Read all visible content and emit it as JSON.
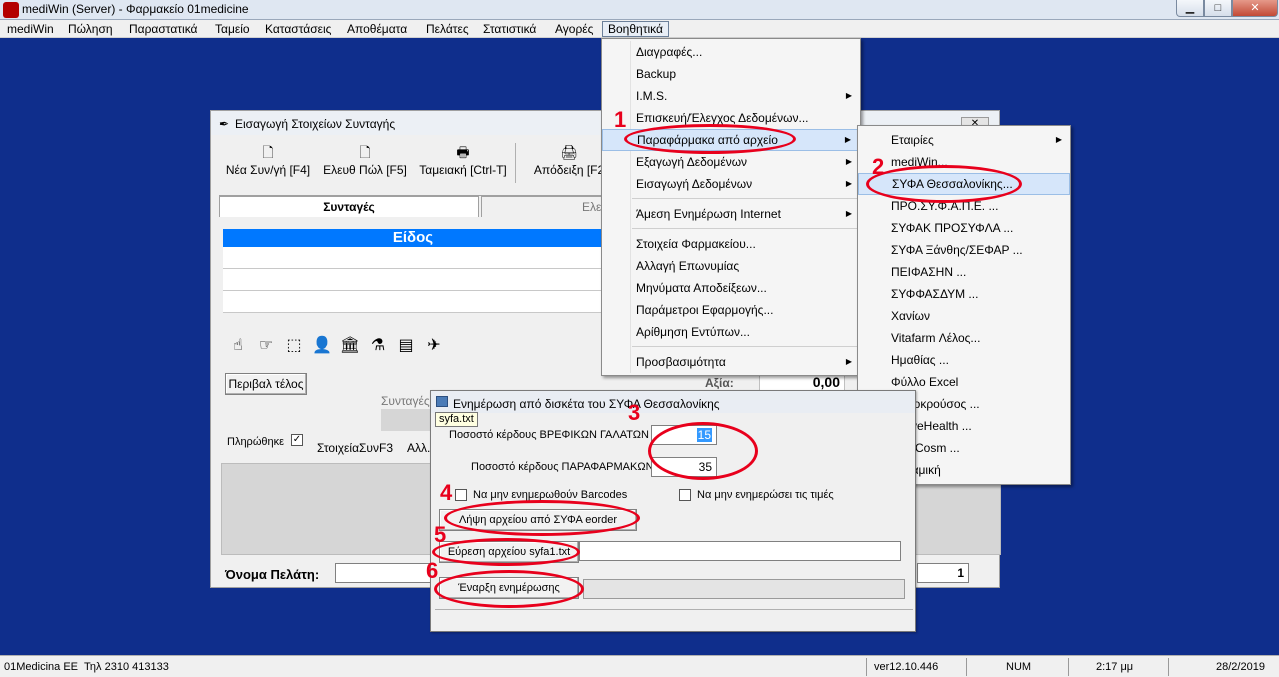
{
  "window": {
    "title": "mediWin (Server) - Φαρμακείο 01medicine",
    "minimize_glyph": "▁",
    "maximize_glyph": "□",
    "close_glyph": "✕"
  },
  "menubar": {
    "items": [
      "mediWin",
      "Πώληση",
      "Παραστατικά",
      "Ταμείο",
      "Καταστάσεις",
      "Αποθέματα",
      "Πελάτες",
      "Στατιστικά",
      "Αγορές",
      "Βοηθητικά"
    ]
  },
  "rx_window": {
    "title": "Εισαγωγή Στοιχείων Συνταγής",
    "close_glyph": "✕",
    "toolbar": [
      "Νέα Συν/γή [F4]",
      "Ελευθ Πώλ [F5]",
      "Ταμειακή [Ctrl-T]",
      "Απόδειξη [F2"
    ],
    "tabs": [
      "Συνταγές",
      "Ελεύθε"
    ],
    "grid_header": "Είδος",
    "cancel_end_button": "Περιβαλ τέλος",
    "rx_label": "Συνταγές",
    "total_label": "Αξία:",
    "total_value": "0,00",
    "filled_label": "Πληρώθηκε",
    "filled_check": "✓",
    "rx_f3_label": "ΣτοιχείαΣυνF3",
    "other_label": "Αλλ.",
    "customer_label": "Όνομα Πελάτη:",
    "counter_value": "1"
  },
  "dropdown": {
    "items": [
      {
        "label": "Διαγραφές...",
        "arrow": ""
      },
      {
        "label": "Backup",
        "arrow": ""
      },
      {
        "label": "I.M.S.",
        "arrow": "▶"
      },
      {
        "label": "Επισκευή/Έλεγχος Δεδομένων...",
        "arrow": ""
      },
      {
        "label": "Παραφάρμακα από αρχείο",
        "arrow": "▶"
      },
      {
        "label": "Εξαγωγή Δεδομένων",
        "arrow": "▶"
      },
      {
        "label": "Εισαγωγή Δεδομένων",
        "arrow": "▶"
      },
      {
        "label": "Άμεση Ενημέρωση Internet",
        "arrow": "▶"
      },
      {
        "label": "Στοιχεία Φαρμακείου...",
        "arrow": ""
      },
      {
        "label": "Αλλαγή Επωνυμίας",
        "arrow": ""
      },
      {
        "label": "Μηνύματα Αποδείξεων...",
        "arrow": ""
      },
      {
        "label": "Παράμετροι Εφαρμογής...",
        "arrow": ""
      },
      {
        "label": "Αρίθμηση Εντύπων...",
        "arrow": ""
      },
      {
        "label": "Προσβασιμότητα",
        "arrow": "▶"
      }
    ]
  },
  "submenu": {
    "items": [
      {
        "label": "Εταιρίες",
        "arrow": "▶"
      },
      {
        "label": "mediWin...",
        "arrow": ""
      },
      {
        "label": "ΣΥΦΑ Θεσσαλονίκης...",
        "arrow": ""
      },
      {
        "label": "ΠΡΟ.ΣΥ.Φ.Α.Π.Ε. ...",
        "arrow": ""
      },
      {
        "label": "ΣΥΦΑΚ ΠΡΟΣΥΦΛΑ ...",
        "arrow": ""
      },
      {
        "label": "ΣΥΦΑ Ξάνθης/ΣΕΦΑΡ ...",
        "arrow": ""
      },
      {
        "label": "ΠΕΙΦΑΣΗΝ ...",
        "arrow": ""
      },
      {
        "label": "ΣΥΦΦΑΣΔΥΜ ...",
        "arrow": ""
      },
      {
        "label": "Χανίων",
        "arrow": ""
      },
      {
        "label": "Vitafarm Λέλος...",
        "arrow": ""
      },
      {
        "label": "Ημαθίας ...",
        "arrow": ""
      },
      {
        "label": "Φύλλο Excel",
        "arrow": ""
      },
      {
        "label": "Μονοκρούσος ...",
        "arrow": ""
      },
      {
        "label": "ActiveHealth ...",
        "arrow": ""
      },
      {
        "label": "InterCosm ...",
        "arrow": ""
      },
      {
        "label": "Δυναμική",
        "arrow": ""
      }
    ]
  },
  "dialog": {
    "title": "Ενημέρωση από δισκέτα του ΣΥΦΑ Θεσσαλονίκης",
    "tooltip": "syfa.txt",
    "baby_milk_label": "Ποσοστό κέρδους ΒΡΕΦΙΚΩΝ ΓΑΛΑΤΩΝ",
    "baby_milk_value": "15",
    "parapharm_label": "Ποσοστό κέρδους ΠΑΡΑΦΑΡΜΑΚΩΝ",
    "parapharm_value": "35",
    "no_barcodes_label": "Να μην ενημερωθούν Barcodes",
    "no_prices_label": "Να μην ενημερώσει τις τιμές",
    "get_file_button": "Λήψη αρχείου από ΣΥΦΑ eorder",
    "find_file_button": "Εύρεση αρχείου syfa1.txt",
    "file_path_value": "",
    "start_button": "Έναρξη ενημέρωσης",
    "progress_value": ""
  },
  "annotations": [
    "1",
    "2",
    "3",
    "4",
    "5",
    "6"
  ],
  "statusbar": {
    "company": "01Medicina EE",
    "phone": "Τηλ 2310 413133",
    "version": "ver12.10.446",
    "num": "NUM",
    "time": "2:17 μμ",
    "date": "28/2/2019"
  }
}
